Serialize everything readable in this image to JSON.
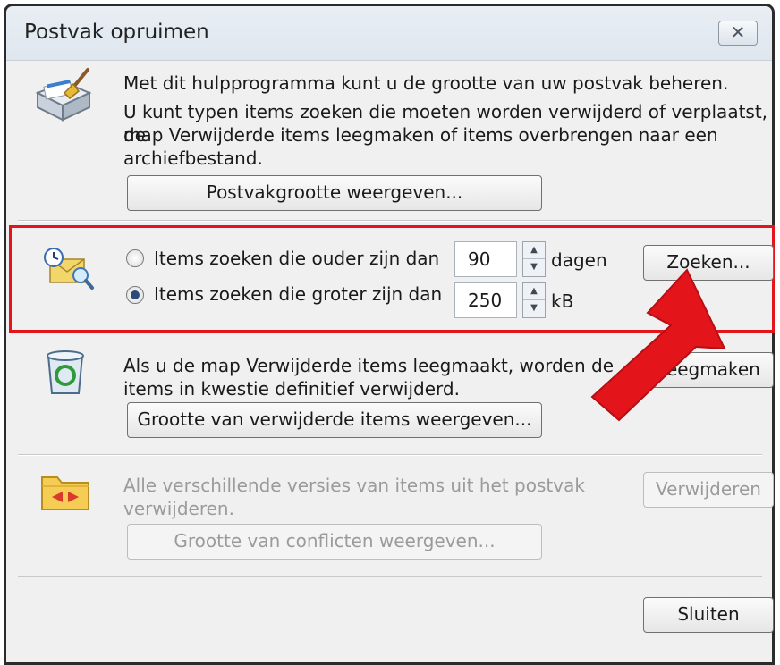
{
  "window": {
    "title": "Postvak opruimen",
    "close_glyph": "✕"
  },
  "colors": {
    "highlight": "#e3151b",
    "arrow": "#e3151b"
  },
  "mailbox": {
    "icon": "broom-box-icon",
    "line1": "Met dit hulpprogramma kunt u de grootte van uw postvak beheren.",
    "line2": "U kunt typen items zoeken die moeten worden verwijderd of verplaatst, de",
    "line3": "map Verwijderde items leegmaken of items overbrengen naar een",
    "line4": "archiefbestand.",
    "button": "Postvakgrootte weergeven..."
  },
  "search": {
    "icon": "clock-mail-search-icon",
    "older_label": "Items zoeken die ouder zijn dan",
    "older_value": "90",
    "older_unit": "dagen",
    "older_checked": false,
    "larger_label": "Items zoeken die groter zijn dan",
    "larger_value": "250",
    "larger_unit": "kB",
    "larger_checked": true,
    "button": "Zoeken..."
  },
  "deleted": {
    "icon": "recycle-bin-icon",
    "line1": "Als u de map Verwijderde items leegmaakt, worden de",
    "line2": "items in kwestie definitief verwijderd.",
    "size_button": "Grootte van verwijderde items weergeven...",
    "empty_button": "Leegmaken"
  },
  "conflicts": {
    "icon": "conflict-folder-icon",
    "line1": "Alle verschillende versies van items uit het postvak",
    "line2": "verwijderen.",
    "size_button": "Grootte van conflicten weergeven...",
    "delete_button": "Verwijderen"
  },
  "footer": {
    "close_button": "Sluiten"
  }
}
